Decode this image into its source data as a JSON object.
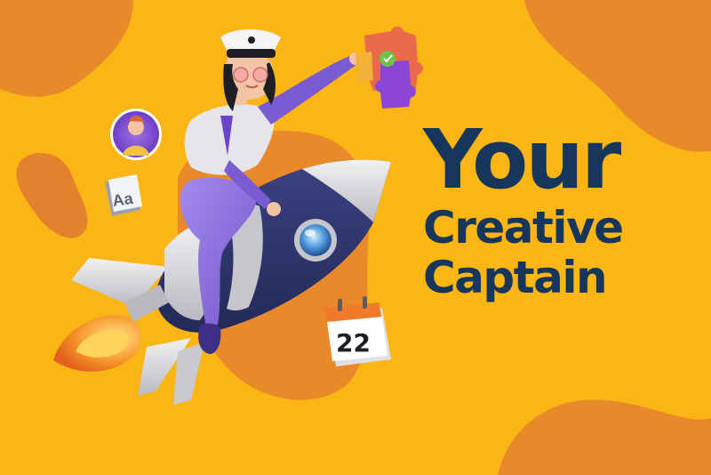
{
  "headline": {
    "line1": "Your",
    "line2": "Creative",
    "line3": "Captain"
  },
  "calendar": {
    "day": "22"
  },
  "font_card": {
    "glyph": "Aa"
  },
  "colors": {
    "background": "#fbb514",
    "blob": "#e88a2a",
    "headline": "#16375b",
    "rocket_body": "#2e356b",
    "rocket_silver": "#d9d9dc",
    "outfit_purple": "#8c6fd6"
  }
}
